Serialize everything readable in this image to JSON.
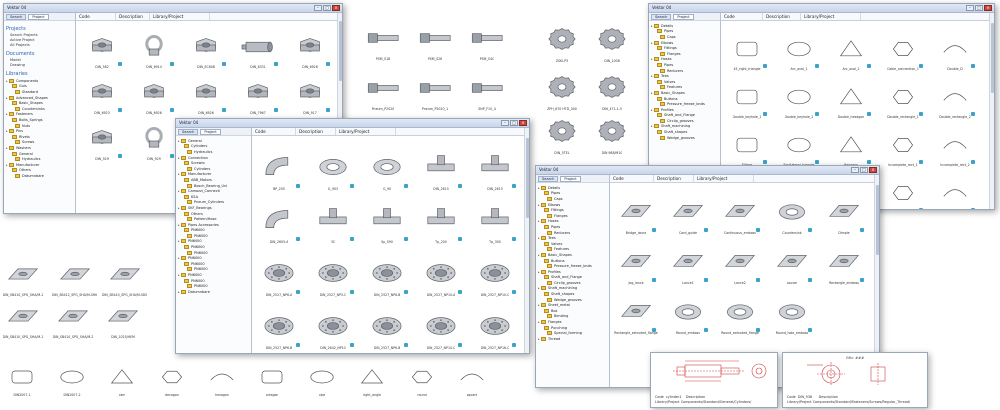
{
  "colors": {
    "accent": "#2b63b6",
    "part_fill": "#c9ccd1",
    "part_edge": "#5d6168",
    "drawing_red": "#d04040",
    "folder": "#f0c548"
  },
  "windows": [
    {
      "title": "Vektor 04",
      "sidebar": {
        "search_tab": "Search",
        "project_tab": "Project",
        "sections": [
          {
            "heading": "Projects",
            "links": [
              "Search Projects",
              "Active Project",
              "All Projects"
            ]
          },
          {
            "heading": "Documents",
            "links": [
              "Model",
              "Drawing"
            ]
          },
          {
            "heading": "Libraries",
            "links": []
          }
        ],
        "tree": [
          "Components",
          "Guis",
          "Standard",
          "Advanced_Shapes",
          "Basic_Shapes",
          "Countersinks",
          "Fasteners",
          "Bolts_Springs",
          "Nuts",
          "Pins",
          "Rivets",
          "Screws",
          "Washers",
          "General",
          "Hydraulics",
          "Manufacturer",
          "Others",
          "Datumnbare"
        ]
      },
      "columns": [
        "Code",
        "Description",
        "Library/Project"
      ],
      "parts": [
        "DIN_582",
        "DIN_6914",
        "DIN_EC608",
        "DIN_6331",
        "DIN_6926",
        "DIN_6923",
        "DIN_6926",
        "DIN_6926",
        "DIN_7967",
        "DIN_917",
        "DIN_929",
        "DIN_929",
        "DIN_EN_ISO_4035",
        "DIN_986"
      ]
    },
    {
      "title": "Vektor 04",
      "sidebar": {
        "search_tab": "Search",
        "project_tab": "Project",
        "tree": [
          "General",
          "Cylinders",
          "Hydraulics",
          "Connection",
          "Screwio",
          "Cylinders",
          "Manufacturer",
          "ABB_Motors",
          "Bosch_Bearing_Uni",
          "Camozzi_Connecti",
          "KSA",
          "Pneum_Cylinders",
          "SKF_Bearings",
          "Others",
          "Pattern/Hose",
          "Pipes Accessories",
          "PN6000",
          "PN6000",
          "PN6000",
          "PN6000",
          "PN6000",
          "PN6000",
          "PN6000",
          "PN6000",
          "PN6000",
          "PN6000",
          "PN6000",
          "Datumnbare"
        ]
      },
      "columns": [
        "Code",
        "Description",
        "Library/Project"
      ],
      "parts": [
        "BP_205",
        "G_903",
        "G_90",
        "DIN_2615",
        "DIN_2615",
        "DIN_2605-A",
        "3C",
        "Sp_S90",
        "Tp_200",
        "Tp_300",
        "DIN_2527_NP6-A",
        "DIN_2527_NP5-C",
        "DIN_2527_NP6-B",
        "DIN_2527_NP10-A",
        "DIN_2527_NP10-C",
        "DIN_2527_NP6-B",
        "DIN_2642_NP10",
        "DIN_2527_NP6-B",
        "DIN_2527_NP10-C",
        "DIN_2527_NP16-C"
      ]
    },
    {
      "title": "Vektor 04",
      "sidebar": {
        "search_tab": "Search",
        "project_tab": "Project",
        "tree": [
          "Details",
          "Pipes",
          "Caps",
          "Elbows",
          "Fittings",
          "Flanges",
          "Hoses",
          "Pipes",
          "Reducers",
          "Tees",
          "Valves",
          "Features",
          "Basic_Shapes",
          "Buttons",
          "Pressure_freeze_bnds",
          "Profiles",
          "Shaft_and_Flange",
          "Circlip_grooves",
          "Shaft_machining",
          "Shaft_shapes",
          "Wedge_grooves",
          "Sheet_metal",
          "Box",
          "Bending",
          "Flanges",
          "Punching",
          "Special_forming",
          "Thread"
        ]
      },
      "columns": [
        "Code",
        "Description",
        "Library/Project"
      ],
      "parts": [
        "Bridge_lance",
        "Card_guide",
        "Continuous_emboss",
        "Countersink",
        "Dimple",
        "Jog_lance",
        "Lance1",
        "Lance2",
        "Louver",
        "Rectangle_emboss",
        "Rectangle_extruded_flange",
        "Round_emboss",
        "Round_extruded_flange",
        "Round_hole_emboss"
      ]
    },
    {
      "title": "Vektor 04",
      "sidebar": {
        "search_tab": "Search",
        "project_tab": "Project",
        "tree": [
          "Details",
          "Pipes",
          "Caps",
          "Elbows",
          "Fittings",
          "Flanges",
          "Hoses",
          "Pipes",
          "Reducers",
          "Tees",
          "Valves",
          "Features",
          "Basic_Shapes",
          "Buttons",
          "Pressure_freeze_bnds",
          "Profiles",
          "Shaft_and_Flange",
          "Circlip_grooves",
          "Shaft_machining",
          "Shaft_shapes",
          "Wedge_grooves"
        ]
      },
      "columns": [
        "Code",
        "Description",
        "Library/Project"
      ],
      "parts": [
        "45_right_triangle",
        "Arc_oval_1",
        "Arc_oval_2",
        "Cable_connection_1",
        "Double_D",
        "Double_keyhole_1",
        "Double_keyhole_2",
        "Double_hexagon",
        "Double_rectangle_1",
        "Double_rectangle_2",
        "Ellipse",
        "Equilateral_triangle",
        "Hexagon",
        "Incomplete_rect_1",
        "Incomplete_rect_2",
        "",
        "",
        "",
        "Keyhole_4",
        "Keyhole_1"
      ]
    }
  ],
  "middle_parts": [
    "PSM_S18",
    "PSM_S26",
    "PSM_S4C",
    "Pneum_P2020",
    "Pneum_P2020_1",
    "SNP_F10_4"
  ],
  "gear_parts": [
    "ZSKI-P3",
    "DIN_1006",
    "ZPH_670 HTD_000",
    "DIN_471-1-5",
    "DIN_5TEL",
    "DIN 988/M10"
  ],
  "sheet_profiles": [
    "DIN_SB410_SPG_SHA/M-1",
    "DIN_SB412_SPG_SHA/M-SHK",
    "DIN_SB410_SPG_SHA/M-SDS",
    "DIN_SB410_SPG_SHA/M-1",
    "DIN_SB410_SPG_SHA/M-2",
    "DIN_1025/HEM"
  ],
  "sketches": [
    "DIN2007-1",
    "DIN2007-2",
    "cam",
    "decagon",
    "hexagon",
    "octagon",
    "pipe",
    "right_angle",
    "round",
    "square"
  ],
  "sheets": [
    {
      "title": "",
      "code_label": "Code",
      "code": "cylinder1",
      "desc_label": "Description",
      "lib_label": "Library/Project",
      "lib": "Components/Standard/General/Cylinders/"
    },
    {
      "title": "Gfi> ###",
      "code_label": "Code",
      "code": "DIN_936",
      "desc_label": "Description",
      "lib_label": "Library/Project",
      "lib": "Components/Standard/Fasteners/Screws/Regular_Thread/"
    }
  ]
}
